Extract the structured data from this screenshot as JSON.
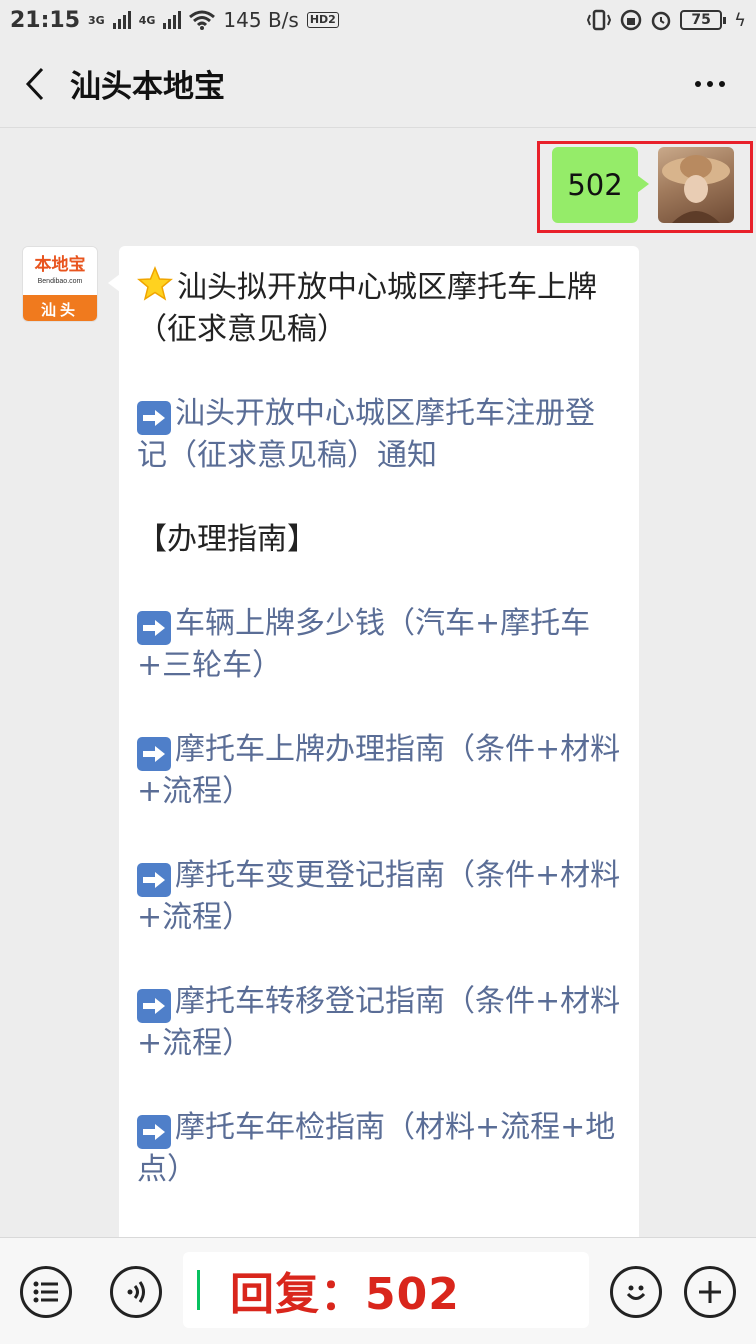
{
  "status_bar": {
    "time": "21:15",
    "net1": "3G",
    "net2": "4G",
    "speed": "145 B/s",
    "battery": "75",
    "hd": "HD2"
  },
  "header": {
    "title": "汕头本地宝"
  },
  "messages": {
    "sent_text": "502",
    "bot_avatar_logo": "本地宝",
    "bot_avatar_url": "Bendibao.com",
    "bot_avatar_city": "汕头",
    "reply_items": [
      {
        "text": "汕头拟开放中心城区摩托车上牌（征求意见稿）",
        "icon": "star-icon",
        "link": false
      },
      {
        "text": "汕头开放中心城区摩托车注册登记（征求意见稿）通知",
        "icon": "arrow-right-icon",
        "link": true
      },
      {
        "text": "【办理指南】",
        "icon": "",
        "link": false
      },
      {
        "text": "车辆上牌多少钱（汽车+摩托车+三轮车）",
        "icon": "arrow-right-icon",
        "link": true
      },
      {
        "text": "摩托车上牌办理指南（条件+材料+流程）",
        "icon": "arrow-right-icon",
        "link": true
      },
      {
        "text": "摩托车变更登记指南（条件+材料+流程）",
        "icon": "arrow-right-icon",
        "link": true
      },
      {
        "text": "摩托车转移登记指南（条件+材料+流程）",
        "icon": "arrow-right-icon",
        "link": true
      },
      {
        "text": "摩托车年检指南（材料+流程+地点）",
        "icon": "arrow-right-icon",
        "link": true
      }
    ]
  },
  "input": {
    "value": "回复：502"
  },
  "colors": {
    "sent_bubble": "#95ec69",
    "link": "#5a6d96",
    "highlight": "#e8202a",
    "input_text": "#d9261c"
  }
}
